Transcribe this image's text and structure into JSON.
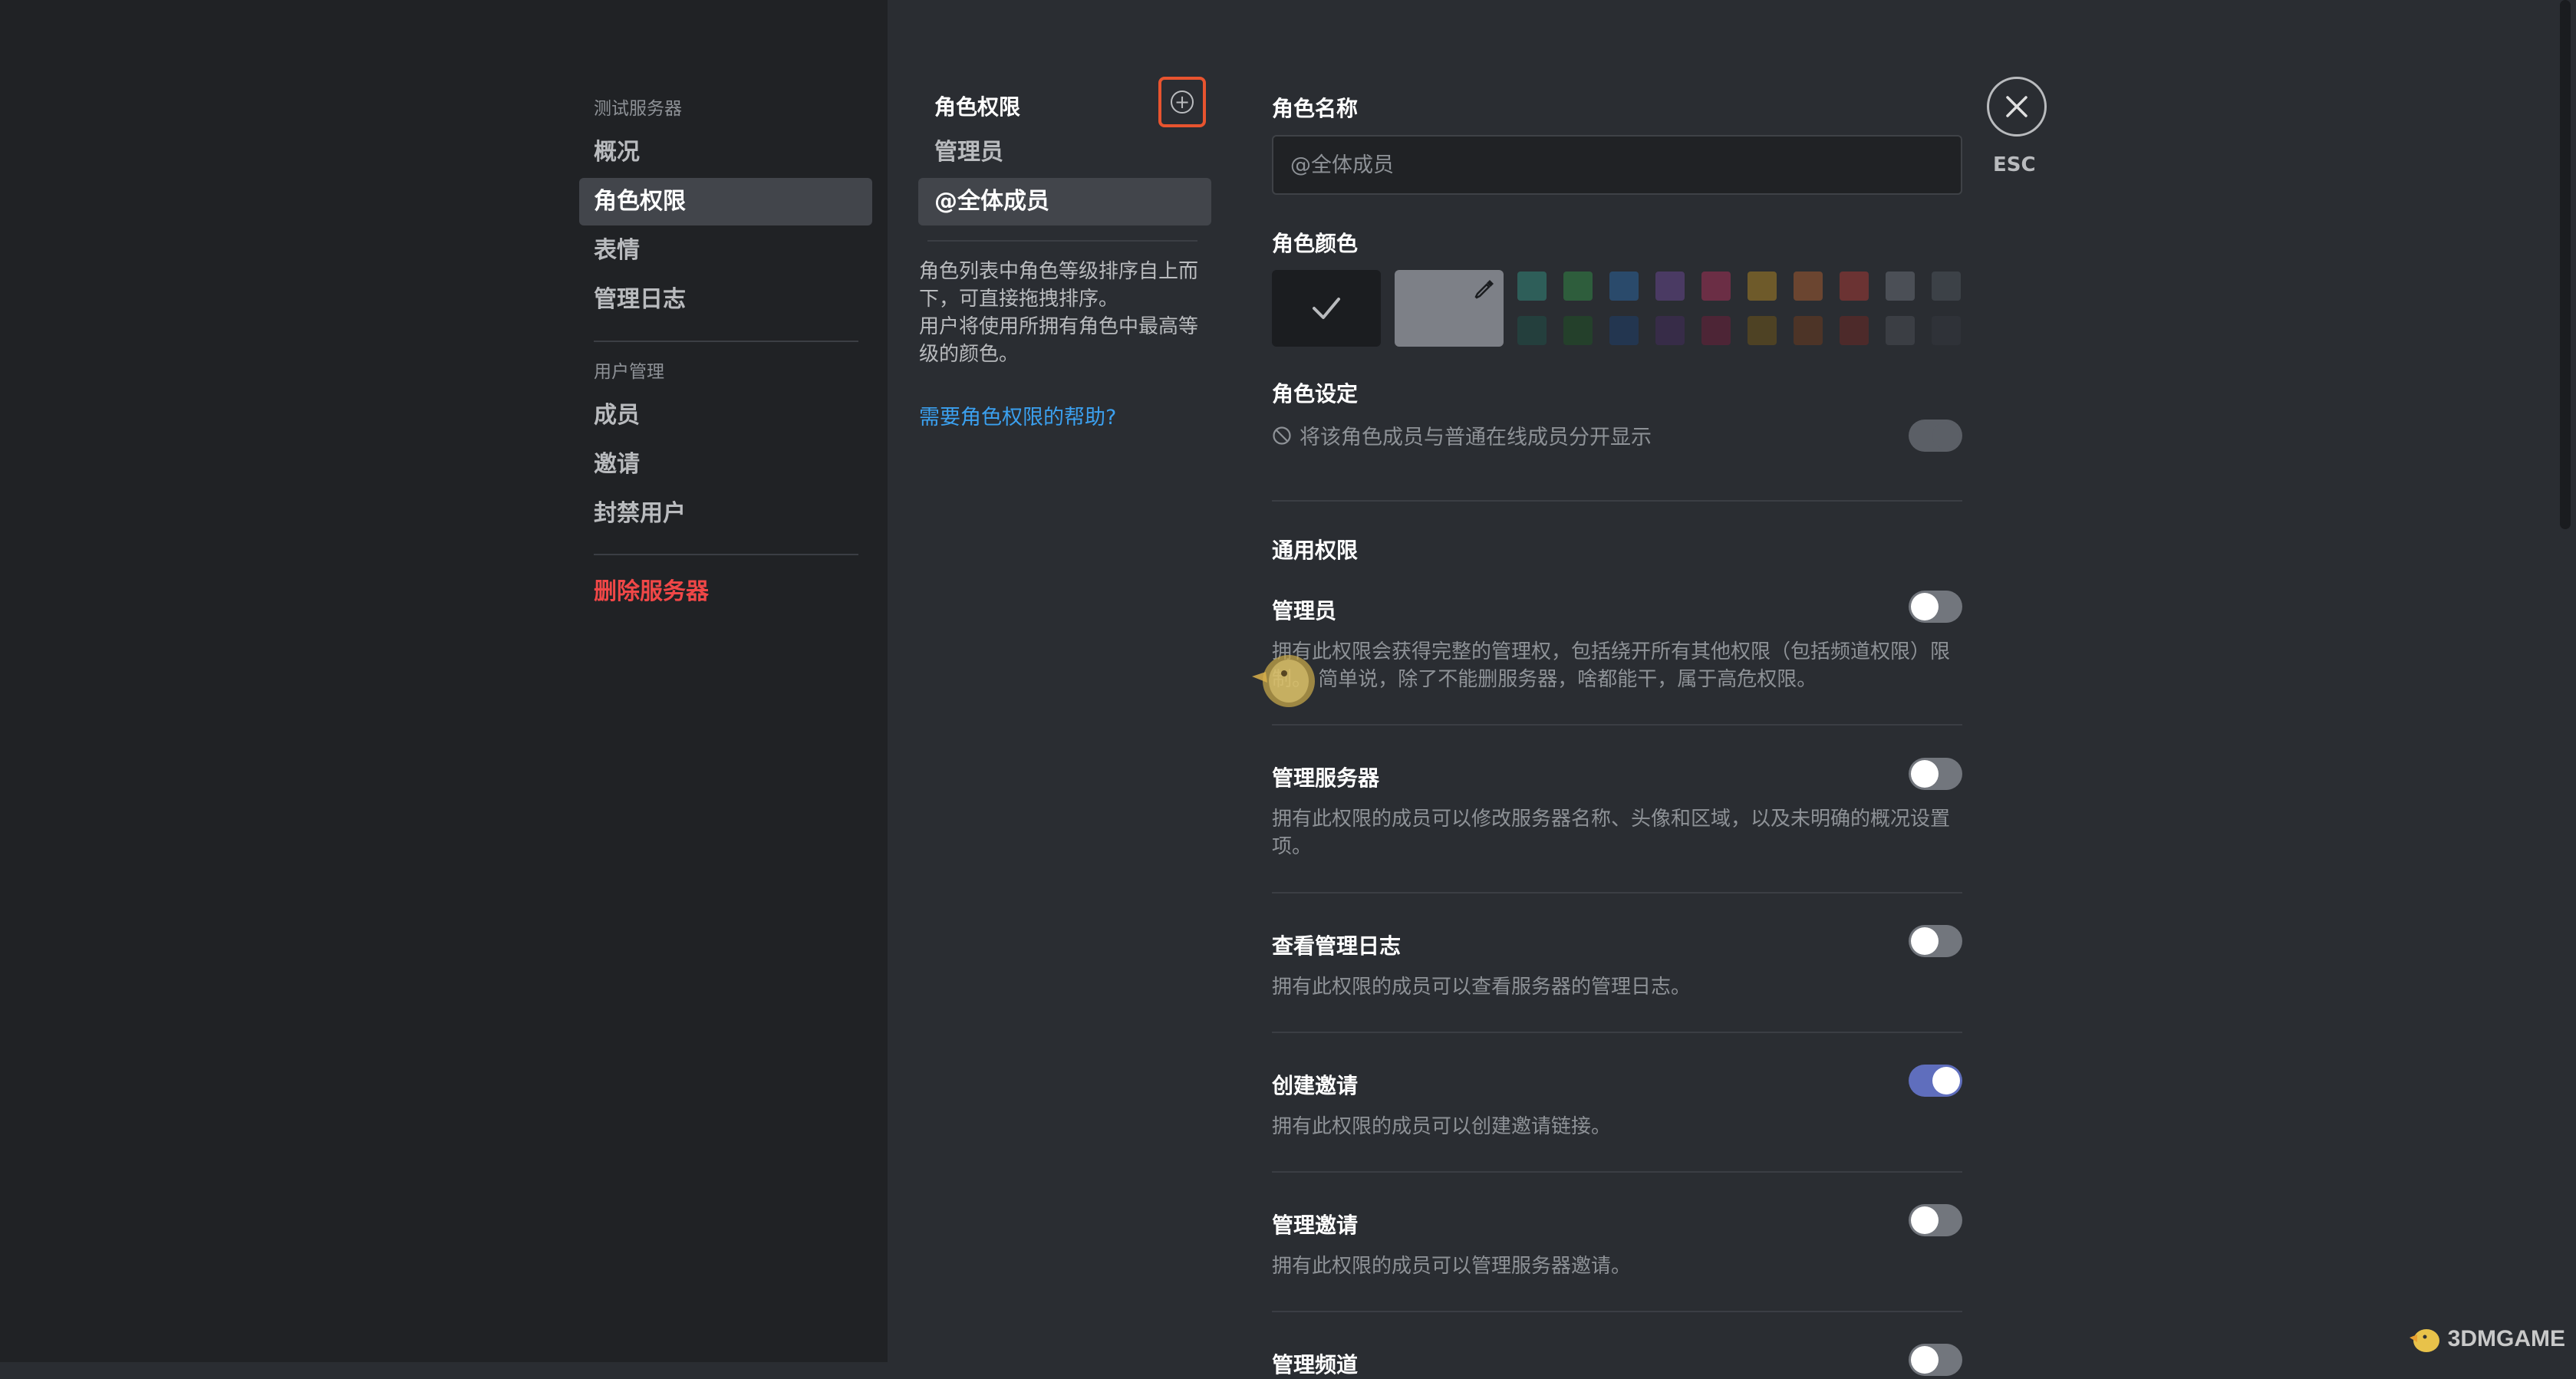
{
  "sidebar": {
    "group1_title": "测试服务器",
    "items": [
      {
        "label": "概况"
      },
      {
        "label": "角色权限"
      },
      {
        "label": "表情"
      },
      {
        "label": "管理日志"
      }
    ],
    "group2_title": "用户管理",
    "items2": [
      {
        "label": "成员"
      },
      {
        "label": "邀请"
      },
      {
        "label": "封禁用户"
      }
    ],
    "delete_label": "删除服务器",
    "active_item": "角色权限"
  },
  "roles": {
    "title": "角色权限",
    "items": [
      {
        "label": "管理员"
      },
      {
        "label": "@全体成员"
      }
    ],
    "active_role": "@全体成员",
    "help_text_1": "角色列表中角色等级排序自上而下，可直接拖拽排序。",
    "help_text_2": "用户将使用所拥有角色中最高等级的颜色。",
    "help_link": "需要角色权限的帮助?"
  },
  "role_form": {
    "name_label": "角色名称",
    "name_placeholder": "@全体成员",
    "color_label": "角色颜色",
    "colors_row1": [
      "#2e5e59",
      "#2e5d3c",
      "#2a4a6b",
      "#4a3a63",
      "#6b2e45",
      "#6e5a2a",
      "#6b4530",
      "#6b3333",
      "#4b4f56",
      "#3c4147"
    ],
    "colors_row2": [
      "#243f3d",
      "#24402b",
      "#233650",
      "#372c48",
      "#4d2536",
      "#4e4224",
      "#4d3427",
      "#4d2a2a",
      "#3b3e44",
      "#2f3238"
    ],
    "settings_label": "角色设定",
    "hoist_desc": "将该角色成员与普通在线成员分开显示",
    "hoist_enabled": false
  },
  "permissions": {
    "section_title": "通用权限",
    "items": [
      {
        "title": "管理员",
        "desc": "拥有此权限会获得完整的管理权，包括绕开所有其他权限（包括频道权限）限制。 简单说，除了不能删服务器，啥都能干，属于高危权限。",
        "enabled": false
      },
      {
        "title": "管理服务器",
        "desc": "拥有此权限的成员可以修改服务器名称、头像和区域，以及未明确的概况设置项。",
        "enabled": false
      },
      {
        "title": "查看管理日志",
        "desc": "拥有此权限的成员可以查看服务器的管理日志。",
        "enabled": false
      },
      {
        "title": "创建邀请",
        "desc": "拥有此权限的成员可以创建邀请链接。",
        "enabled": true
      },
      {
        "title": "管理邀请",
        "desc": "拥有此权限的成员可以管理服务器邀请。",
        "enabled": false
      },
      {
        "title": "管理频道",
        "desc": "",
        "enabled": false
      }
    ]
  },
  "close": {
    "label": "ESC"
  },
  "watermark": {
    "text": "3DMGAME"
  },
  "colors": {
    "accent": "#5f6ebd",
    "danger": "#f04747",
    "link": "#3ba0ef",
    "highlight_border": "#e8542f"
  }
}
